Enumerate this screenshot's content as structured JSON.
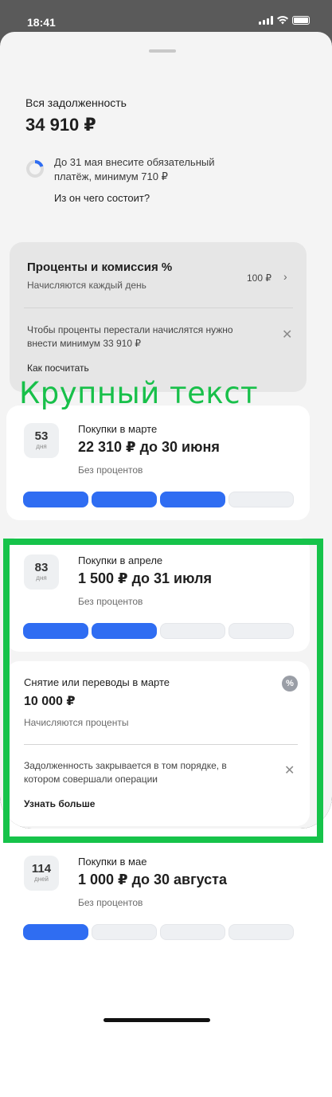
{
  "status_bar": {
    "time": "18:41"
  },
  "summary": {
    "title": "Вся задолженность",
    "amount": "34 910 ₽",
    "due_text": "До 31 мая внесите обязательный платёж, минимум 710 ₽",
    "breakdown_link": "Из он чего состоит?"
  },
  "interest_card": {
    "title": "Проценты и комиссия %",
    "subtitle": "Начисляются каждый день",
    "amount": "100 ₽",
    "hint": "Чтобы проценты перестали начислятся нужно внести минимум 33 910 ₽",
    "link": "Как посчитать"
  },
  "overlay_text": "Крупный текст",
  "purchases": [
    {
      "days": "53",
      "days_unit": "дня",
      "title": "Покупки в марте",
      "amount": "22 310 ₽ до 30 июня",
      "note": "Без процентов",
      "filled_segments": 3,
      "total_segments": 4
    },
    {
      "days": "83",
      "days_unit": "дня",
      "title": "Покупки в апреле",
      "amount": "1 500 ₽ до 31 июля",
      "note": "Без процентов",
      "filled_segments": 2,
      "total_segments": 4
    },
    {
      "days": "114",
      "days_unit": "дней",
      "title": "Покупки в мае",
      "amount": "1 000 ₽ до 30 августа",
      "note": "Без процентов",
      "filled_segments": 1,
      "total_segments": 4
    }
  ],
  "withdrawal_card": {
    "title": "Снятие или переводы в марте",
    "amount": "10 000 ₽",
    "subtitle": "Начисляются проценты",
    "hint": "Задолженность закрывается в том порядке, в котором совершали операции",
    "link": "Узнать больше"
  },
  "colors": {
    "accent": "#2f6df2",
    "highlight": "#16c34a",
    "overlay_text": "#18c04a"
  },
  "icons": [
    "signal-icon",
    "wifi-icon",
    "battery-icon",
    "progress-ring-icon",
    "chevron-right-icon",
    "close-icon",
    "percent-icon"
  ]
}
